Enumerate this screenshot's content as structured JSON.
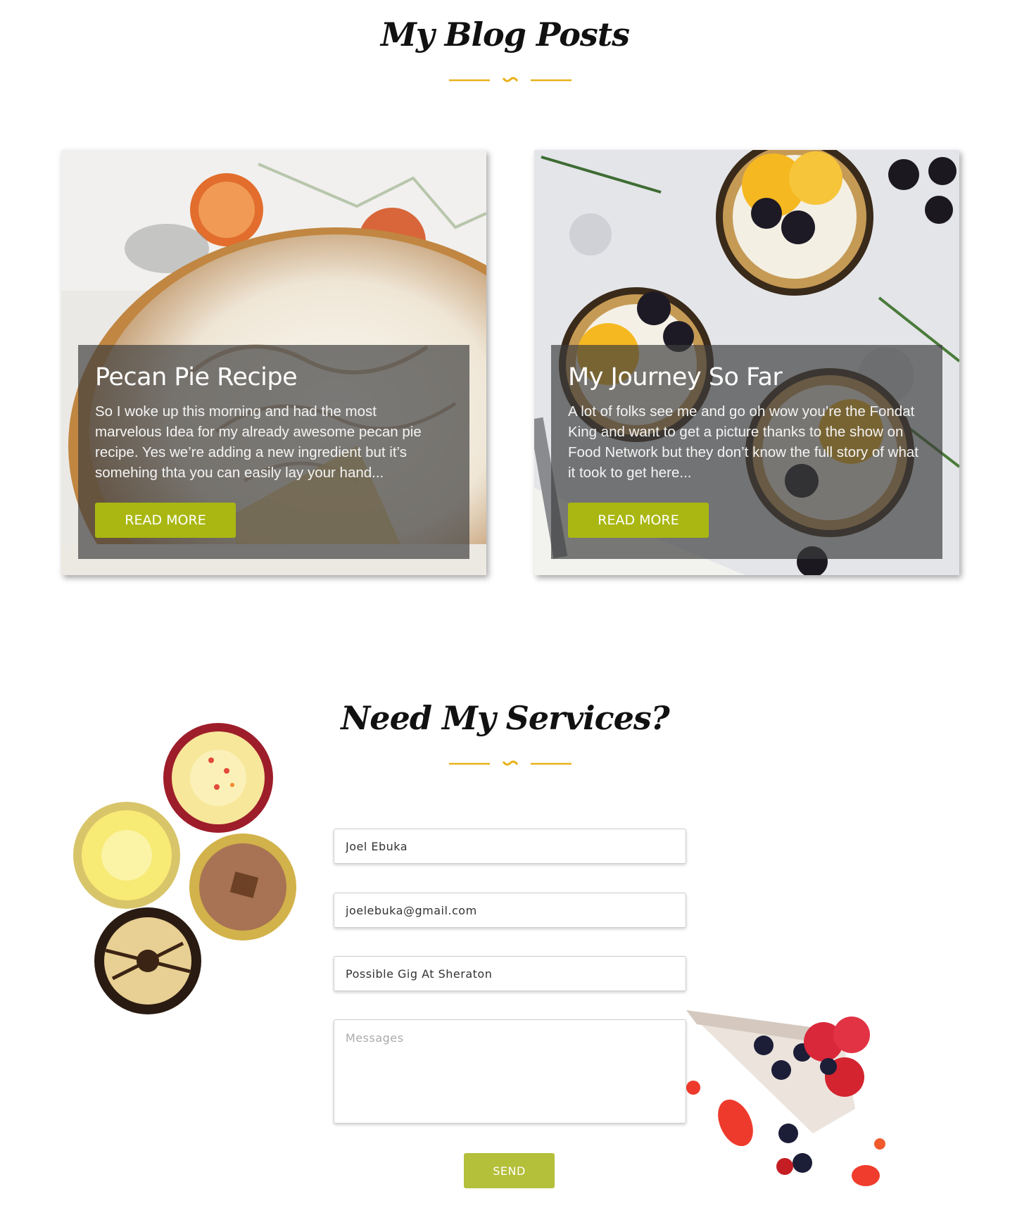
{
  "blog": {
    "title": "My Blog Posts",
    "posts": [
      {
        "title": "Pecan Pie Recipe",
        "excerpt": "So I woke up this morning and had the most marvelous Idea for my already awesome pecan pie recipe. Yes we’re adding a new ingredient but it’s somehing thta you can easily lay your hand...",
        "button": "READ MORE"
      },
      {
        "title": "My Journey So Far",
        "excerpt": "A lot of folks see me and go oh wow you’re the Fondat King and want to get a picture thanks to the show on Food Network but they don’t know the full story of what it took to get here...",
        "button": "READ MORE"
      }
    ]
  },
  "contact": {
    "title": "Need My Services?",
    "name_value": "Joel Ebuka",
    "email_value": "joelebuka@gmail.com",
    "subject_value": "Possible Gig At Sheraton",
    "message_placeholder": "Messages",
    "send_label": "SEND"
  },
  "colors": {
    "accent_gold": "#e8b21a",
    "button_green": "#aab712",
    "send_green": "#b4bf3a"
  }
}
